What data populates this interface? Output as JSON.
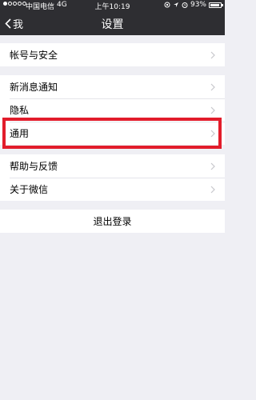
{
  "status_bar": {
    "carrier": "中国电信",
    "network": "4G",
    "time": "上午10:19",
    "battery": "93%"
  },
  "nav": {
    "back_label": "我",
    "title": "设置"
  },
  "groups": [
    {
      "items": [
        "帐号与安全"
      ]
    },
    {
      "items": [
        "新消息通知",
        "隐私",
        "通用"
      ]
    },
    {
      "items": [
        "帮助与反馈",
        "关于微信"
      ]
    }
  ],
  "logout_label": "退出登录",
  "colors": {
    "navbar_bg": "#2e2e32",
    "page_bg": "#efeff4",
    "highlight": "#e21c2b"
  }
}
